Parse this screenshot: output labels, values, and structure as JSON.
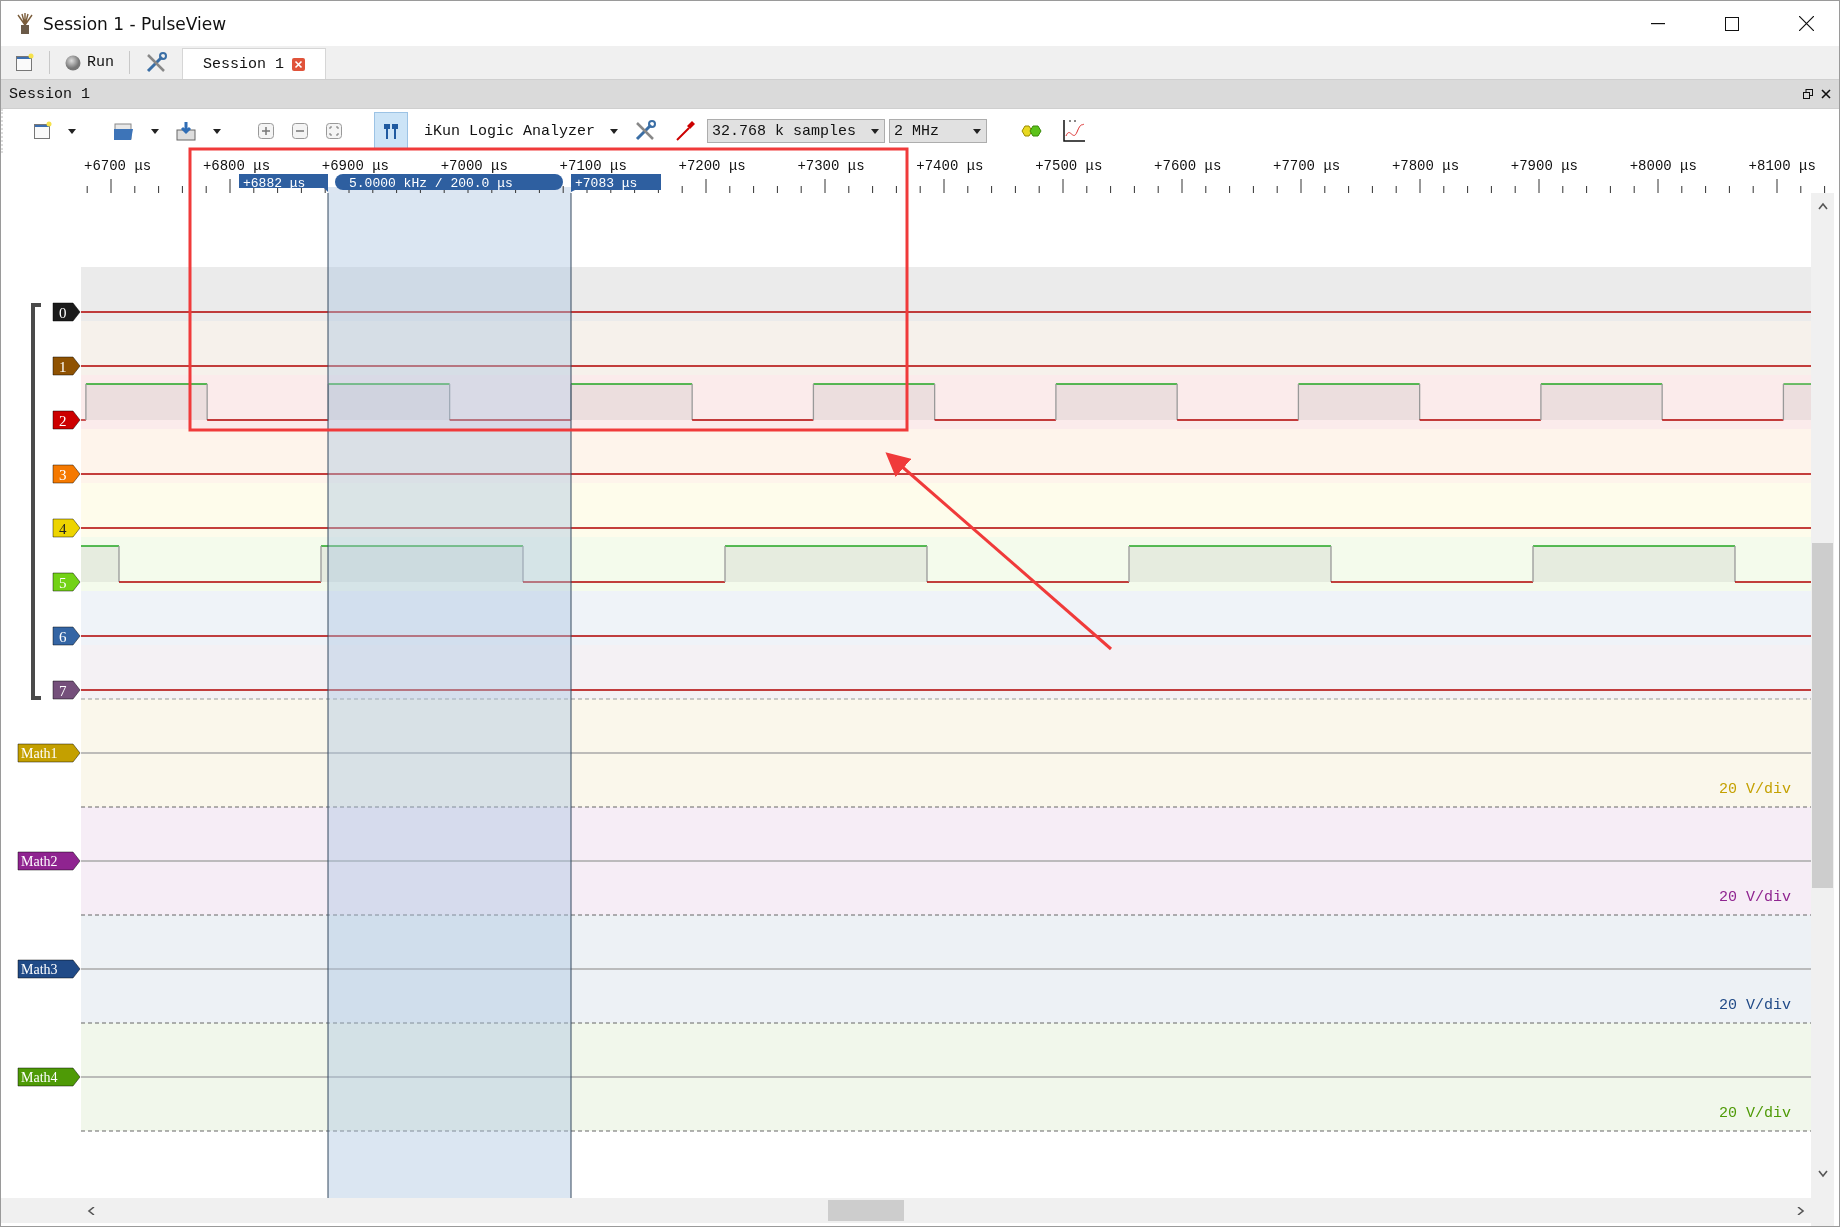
{
  "window": {
    "title": "Session 1 - PulseView"
  },
  "tab_bar": {
    "run_button": "Run",
    "tabs": [
      {
        "label": "Session 1",
        "selected": true
      }
    ]
  },
  "session_panel": {
    "title": "Session 1"
  },
  "toolbar": {
    "cursors_on": true,
    "device": "iKun Logic Analyzer",
    "sample_count": "32.768 k samples",
    "sample_rate": "2 MHz"
  },
  "ruler": {
    "ticks": [
      "+6700 μs",
      "+6800 μs",
      "+6900 μs",
      "+7000 μs",
      "+7100 μs",
      "+7200 μs",
      "+7300 μs",
      "+7400 μs",
      "+7500 μs",
      "+7600 μs",
      "+7700 μs",
      "+7800 μs",
      "+7900 μs",
      "+8000 μs",
      "+8100 μs"
    ]
  },
  "cursors": {
    "start": "+6882 μs",
    "span": "5.0000 kHz / 200.0 μs",
    "end": "+7083 μs"
  },
  "channels": [
    {
      "name": "0",
      "color": "#1b1b1b",
      "kind": "low"
    },
    {
      "name": "1",
      "color": "#8f5202",
      "kind": "low"
    },
    {
      "name": "2",
      "color": "#cc0000",
      "kind": "fast"
    },
    {
      "name": "3",
      "color": "#f57900",
      "kind": "low"
    },
    {
      "name": "4",
      "color": "#edd400",
      "kind": "low"
    },
    {
      "name": "5",
      "color": "#73d216",
      "kind": "slow"
    },
    {
      "name": "6",
      "color": "#3465a4",
      "kind": "low"
    },
    {
      "name": "7",
      "color": "#75507b",
      "kind": "low"
    }
  ],
  "math_traces": [
    {
      "name": "Math1",
      "color": "#c4a000",
      "scale": "20 V/div"
    },
    {
      "name": "Math2",
      "color": "#8f2490",
      "scale": "20 V/div"
    },
    {
      "name": "Math3",
      "color": "#204a87",
      "scale": "20 V/div"
    },
    {
      "name": "Math4",
      "color": "#4e9a06",
      "scale": "20 V/div"
    }
  ]
}
